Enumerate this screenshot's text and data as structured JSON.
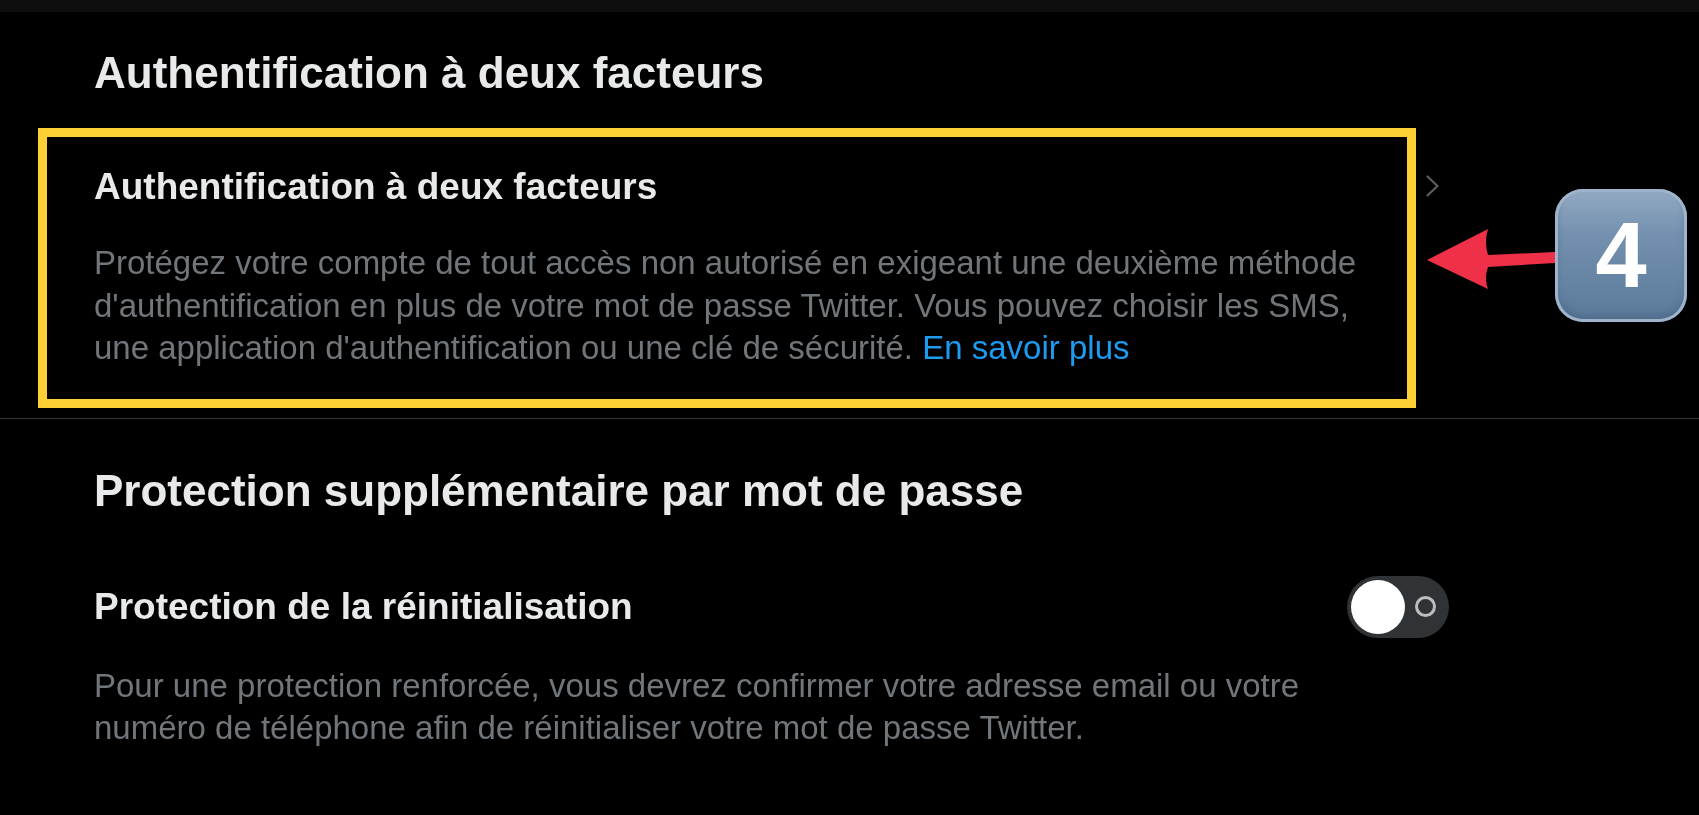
{
  "sections": [
    {
      "title": "Authentification à deux facteurs",
      "items": [
        {
          "kind": "link",
          "title": "Authentification à deux facteurs",
          "description": "Protégez votre compte de tout accès non autorisé en exigeant une deuxième méthode d'authentification en plus de votre mot de passe Twitter. Vous pouvez choisir les SMS, une application d'authentification ou une clé de sécurité.",
          "link": "En savoir plus",
          "highlighted": true
        }
      ]
    },
    {
      "title": "Protection supplémentaire par mot de passe",
      "items": [
        {
          "kind": "toggle",
          "title": "Protection de la réinitialisation",
          "on": false,
          "description": "Pour une protection renforcée, vous devrez confirmer votre adresse email ou votre numéro de téléphone afin de réinitialiser votre mot de passe Twitter."
        }
      ]
    }
  ],
  "annotation": {
    "badge": "4"
  }
}
